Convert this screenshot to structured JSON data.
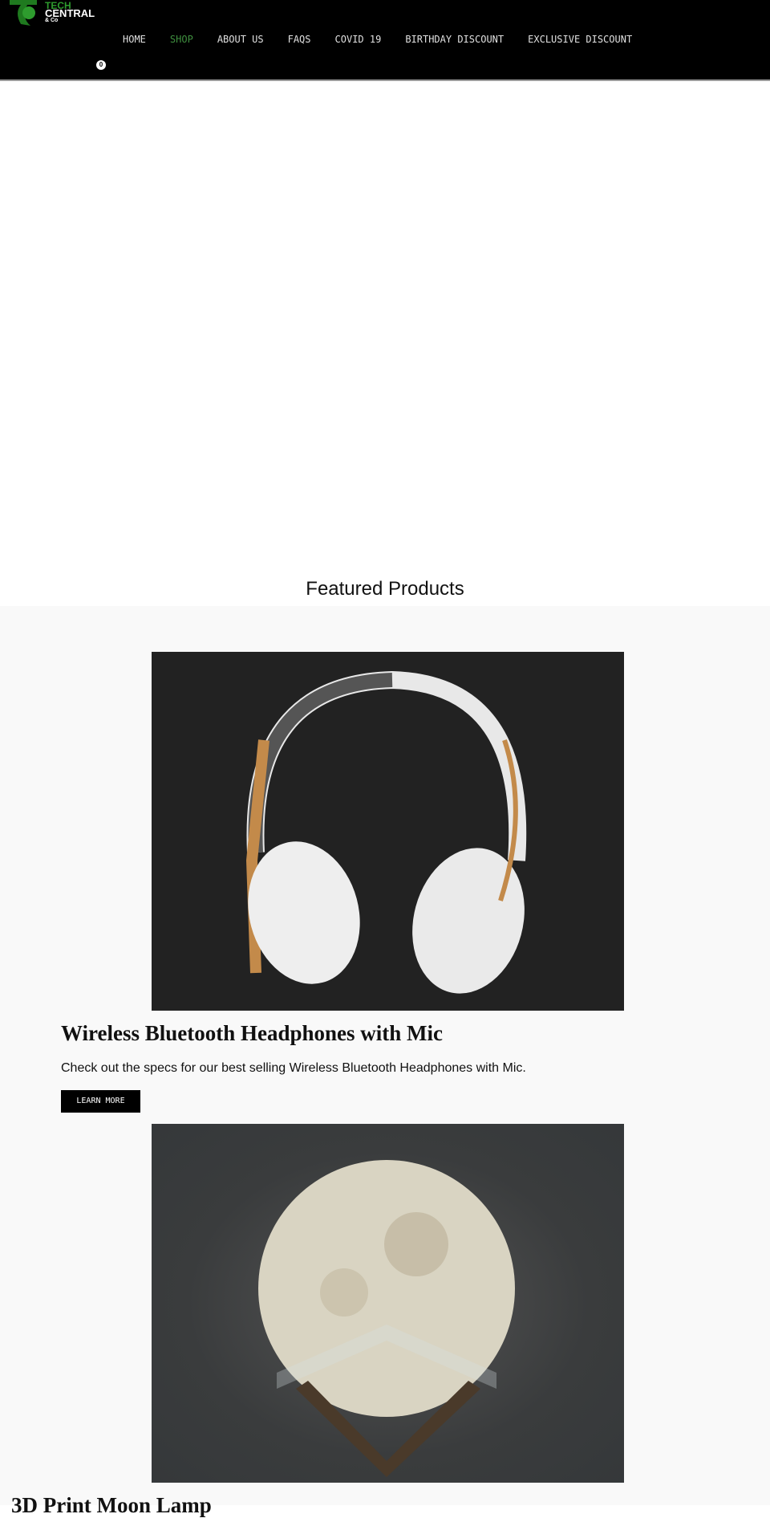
{
  "header": {
    "logo": {
      "line1": "TECH",
      "line2": "CENTRAL",
      "line3": "& Co"
    },
    "nav": [
      "HOME",
      "SHOP",
      "ABOUT US",
      "FAQS",
      "COVID 19",
      "BIRTHDAY DISCOUNT",
      "EXCLUSIVE DISCOUNT"
    ],
    "active_nav": "SHOP",
    "cart_count": "0",
    "accent": "#3f8f3f"
  },
  "main": {
    "section_title": "Featured Products",
    "products": [
      {
        "title": "Wireless Bluetooth Headphones with Mic",
        "description": "Check out the specs for our best selling Wireless Bluetooth Headphones with Mic.",
        "button": "LEARN MORE"
      },
      {
        "title": "3D Print Moon Lamp"
      }
    ]
  }
}
